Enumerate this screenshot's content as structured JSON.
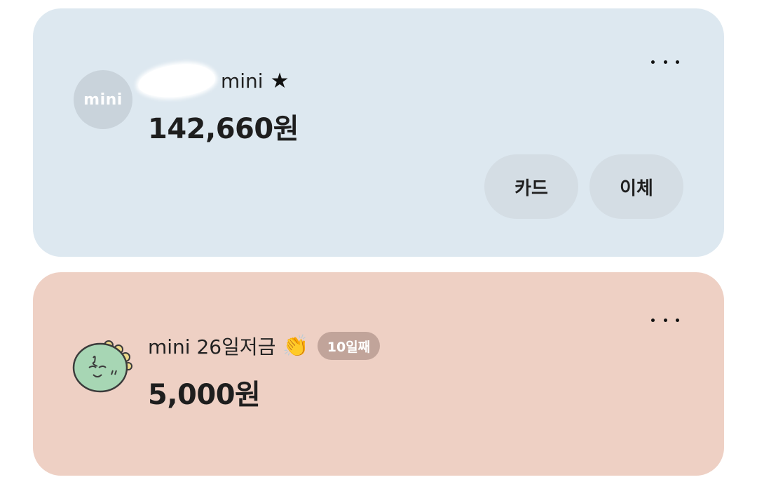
{
  "accounts": [
    {
      "avatar_text": "mini",
      "name": "mini",
      "star": "★",
      "amount": "142,660원",
      "more_icon": "more-horizontal-icon",
      "buttons": {
        "card": "카드",
        "transfer": "이체"
      },
      "colors": {
        "background": "#dde8f0",
        "avatar": "#c9d3db",
        "button": "#d4dde4"
      }
    },
    {
      "avatar_icon": "green-character-avatar",
      "name": "mini 26일저금",
      "clap_emoji": "👏",
      "badge": "10일째",
      "amount": "5,000원",
      "more_icon": "more-horizontal-icon",
      "colors": {
        "background": "#eed0c4",
        "badge": "#c1a49a"
      }
    }
  ]
}
